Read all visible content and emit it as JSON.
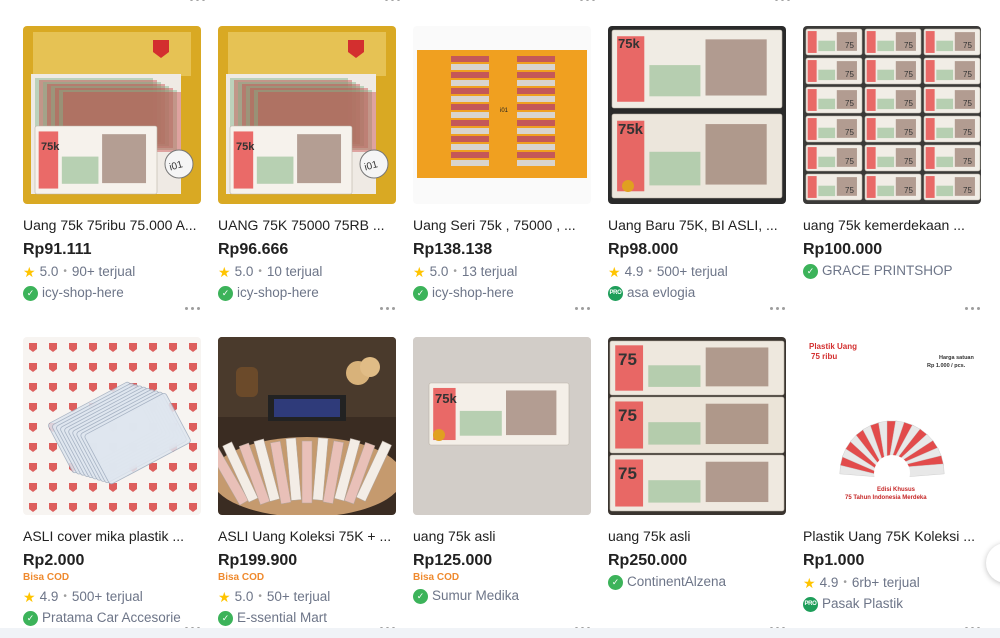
{
  "colors": {
    "price": "#212121",
    "cod": "#ef8a2e",
    "star": "#ffc400",
    "muted": "#6d7588",
    "badge_green": "#3cb35a"
  },
  "rows": [
    [
      {
        "title": "Uang 75k 75ribu 75.000 A...",
        "price": "Rp91.111",
        "cod": "",
        "rating": "5.0",
        "sold": "90+ terjual",
        "shop": "icy-shop-here",
        "badge": "green"
      },
      {
        "title": "UANG 75K 75000 75RB ...",
        "price": "Rp96.666",
        "cod": "",
        "rating": "5.0",
        "sold": "10 terjual",
        "shop": "icy-shop-here",
        "badge": "green"
      },
      {
        "title": "Uang Seri 75k , 75000 , ...",
        "price": "Rp138.138",
        "cod": "",
        "rating": "5.0",
        "sold": "13 terjual",
        "shop": "icy-shop-here",
        "badge": "green"
      },
      {
        "title": "Uang Baru 75K, BI ASLI, ...",
        "price": "Rp98.000",
        "cod": "",
        "rating": "4.9",
        "sold": "500+ terjual",
        "shop": "asa evlogia",
        "badge": "pro"
      },
      {
        "title": "uang 75k kemerdekaan ...",
        "price": "Rp100.000",
        "cod": "",
        "rating": "",
        "sold": "",
        "shop": "GRACE PRINTSHOP",
        "badge": "green"
      }
    ],
    [
      {
        "title": "ASLI cover mika plastik ...",
        "price": "Rp2.000",
        "cod": "Bisa COD",
        "rating": "4.9",
        "sold": "500+ terjual",
        "shop": "Pratama Car Accesorie",
        "badge": "green"
      },
      {
        "title": "ASLI Uang Koleksi 75K + ...",
        "price": "Rp199.900",
        "cod": "Bisa COD",
        "rating": "5.0",
        "sold": "50+ terjual",
        "shop": "E-ssential Mart",
        "badge": "green"
      },
      {
        "title": "uang 75k asli",
        "price": "Rp125.000",
        "cod": "Bisa COD",
        "rating": "",
        "sold": "",
        "shop": "Sumur Medika",
        "badge": "green"
      },
      {
        "title": "uang 75k asli",
        "price": "Rp250.000",
        "cod": "",
        "rating": "",
        "sold": "",
        "shop": "ContinentAlzena",
        "badge": "green"
      },
      {
        "title": "Plastik Uang 75K Koleksi ...",
        "price": "Rp1.000",
        "cod": "",
        "rating": "4.9",
        "sold": "6rb+ terjual",
        "shop": "Pasak Plastik",
        "badge": "pro"
      }
    ]
  ],
  "thumb_text": {
    "banknote_value": "75",
    "banknote_value_k": "75k",
    "label_101": "i01",
    "plastic_title": "Plastik Uang\n75 ribu",
    "plastic_title_line1": "Plastik Uang",
    "plastic_title_line2": "75 ribu",
    "plastic_price_line1": "Harga satuan",
    "plastic_price_line2": "Rp 1.000 / pcs.",
    "plastic_footer_line1": "Edisi Khusus",
    "plastic_footer_line2": "75 Tahun Indonesia Merdeka"
  },
  "badge_text": {
    "pro": "PRO",
    "green": "✓"
  },
  "icons": {
    "star": "star-icon",
    "more": "more-options-icon"
  }
}
